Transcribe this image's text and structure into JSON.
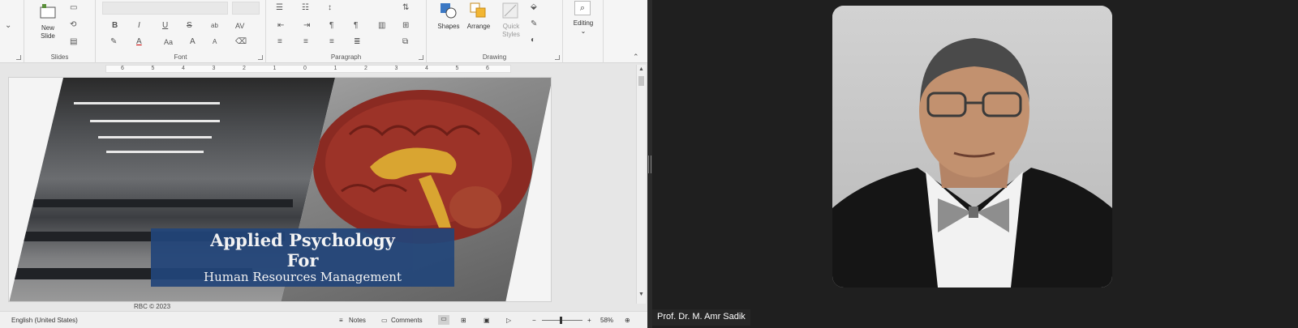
{
  "ribbon": {
    "groups": {
      "slides": "Slides",
      "font": "Font",
      "paragraph": "Paragraph",
      "drawing": "Drawing"
    },
    "new_slide_line1": "New",
    "new_slide_line2": "Slide",
    "font_buttons": [
      "B",
      "I",
      "U",
      "S",
      "ab",
      "AV"
    ],
    "font_size_buttons": [
      "Aa",
      "A",
      "A"
    ],
    "shapes_label": "Shapes",
    "arrange_label": "Arrange",
    "quick_styles_line1": "Quick",
    "quick_styles_line2": "Styles",
    "editing_label": "Editing"
  },
  "ruler": {
    "ticks": [
      "6",
      "5",
      "4",
      "3",
      "2",
      "1",
      "0",
      "1",
      "2",
      "3",
      "4",
      "5",
      "6"
    ]
  },
  "slide": {
    "title_line1": "Applied Psychology",
    "title_line2": "For",
    "subtitle": "Human Resources Management",
    "copyright": "RBC © 2023"
  },
  "status": {
    "language": "English (United States)",
    "notes": "Notes",
    "comments": "Comments",
    "zoom": "58%"
  },
  "video": {
    "speaker_name": "Prof. Dr. M. Amr Sadik"
  },
  "colors": {
    "title_box": "#22457a",
    "meeting_bg": "#1f1f1f",
    "ribbon_bg": "#f5f5f5"
  }
}
